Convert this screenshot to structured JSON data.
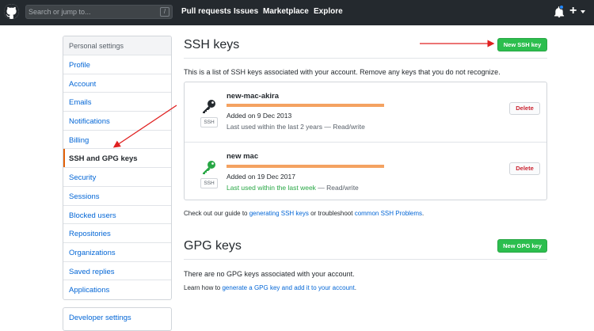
{
  "header": {
    "search_placeholder": "Search or jump to...",
    "search_shortcut": "/",
    "nav": [
      "Pull requests",
      "Issues",
      "Marketplace",
      "Explore"
    ],
    "plus_label": "+"
  },
  "sidebar": {
    "heading": "Personal settings",
    "items": [
      "Profile",
      "Account",
      "Emails",
      "Notifications",
      "Billing",
      "SSH and GPG keys",
      "Security",
      "Sessions",
      "Blocked users",
      "Repositories",
      "Organizations",
      "Saved replies",
      "Applications"
    ],
    "active_index": 5,
    "developer_settings": "Developer settings"
  },
  "ssh": {
    "title": "SSH keys",
    "new_button": "New SSH key",
    "description": "This is a list of SSH keys associated with your account. Remove any keys that you do not recognize.",
    "keys": [
      {
        "name": "new-mac-akira",
        "tag": "SSH",
        "added": "Added on 9 Dec 2013",
        "last_used": "Last used within the last 2 years",
        "access": " — Read/write",
        "delete_label": "Delete",
        "icon_color": "#24292e",
        "recent": false
      },
      {
        "name": "new mac",
        "tag": "SSH",
        "added": "Added on 19 Dec 2017",
        "last_used": "Last used within the last week",
        "access": " — Read/write",
        "delete_label": "Delete",
        "icon_color": "#28a745",
        "recent": true
      }
    ],
    "help_prefix": "Check out our guide to ",
    "help_link1": "generating SSH keys",
    "help_middle": " or troubleshoot ",
    "help_link2": "common SSH Problems",
    "help_suffix": "."
  },
  "gpg": {
    "title": "GPG keys",
    "new_button": "New GPG key",
    "empty_text": "There are no GPG keys associated with your account.",
    "learn_prefix": "Learn how to ",
    "learn_link": "generate a GPG key and add it to your account",
    "learn_suffix": "."
  },
  "colors": {
    "header_bg": "#24292e",
    "link": "#0366d6",
    "primary_button": "#2cbe4e",
    "danger": "#cb2431",
    "annotation_arrow": "#e02020"
  }
}
